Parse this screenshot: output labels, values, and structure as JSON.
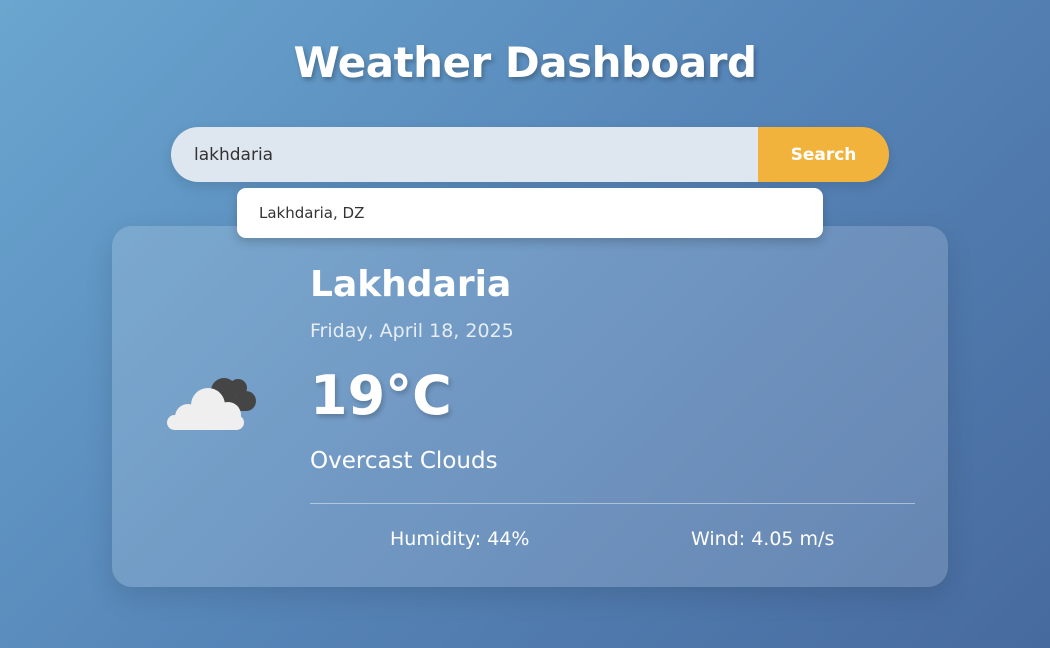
{
  "header": {
    "title": "Weather Dashboard"
  },
  "search": {
    "value": "lakhdaria",
    "button_label": "Search",
    "suggestions": [
      "Lakhdaria, DZ"
    ]
  },
  "weather": {
    "city": "Lakhdaria",
    "date": "Friday, April 18, 2025",
    "temperature": "19°C",
    "description": "Overcast Clouds",
    "icon": "overcast-clouds-icon",
    "humidity": "Humidity: 44%",
    "wind": "Wind: 4.05 m/s"
  },
  "colors": {
    "button": "#f2b33c",
    "input_background": "#dee6ef",
    "background_start": "#6aa6cf",
    "background_end": "#476a9e"
  }
}
